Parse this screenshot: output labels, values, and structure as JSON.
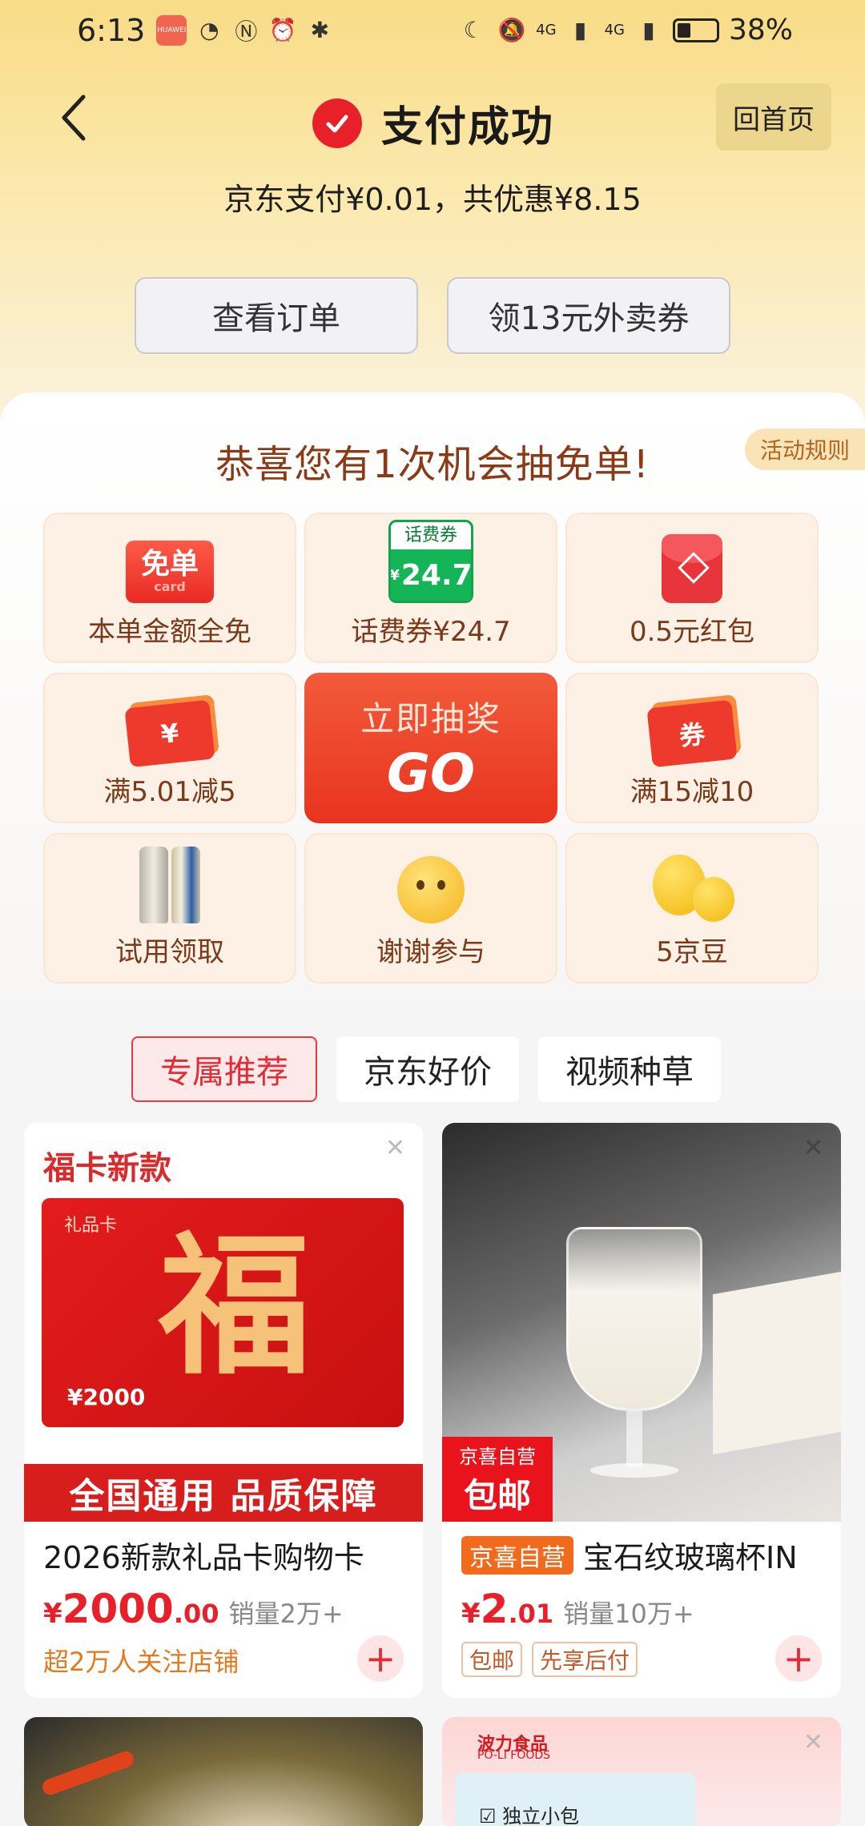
{
  "status_bar": {
    "time": "6:13",
    "app_badge": "HUAWEI",
    "network_1": "4G",
    "network_2": "4G",
    "battery": "38%",
    "battery_level": 0.38
  },
  "header": {
    "title": "支付成功",
    "home_button": "回首页"
  },
  "payment_summary": "京东支付¥0.01，共优惠¥8.15",
  "actions": {
    "view_order": "查看订单",
    "coupon": "领13元外卖券"
  },
  "lottery": {
    "title": "恭喜您有1次机会抽免单!",
    "rules": "活动规则",
    "go_top": "立即抽奖",
    "go_text": "GO",
    "free_icon": "免单",
    "free_icon_sub": "card",
    "phone_icon_top": "话费券",
    "phone_icon_symbol": "¥",
    "phone_icon_value": "24.7",
    "ticket_yen": "¥",
    "ticket_quan": "券",
    "items": [
      {
        "label": "本单金额全免",
        "icon": "free-order-icon"
      },
      {
        "label": "话费券¥24.7",
        "icon": "phone-credit-icon"
      },
      {
        "label": "0.5元红包",
        "icon": "red-packet-icon"
      },
      {
        "label": "满5.01减5",
        "icon": "yen-ticket-icon"
      },
      {
        "label": "满15减10",
        "icon": "coupon-ticket-icon"
      },
      {
        "label": "试用领取",
        "icon": "beer-can-icon"
      },
      {
        "label": "谢谢参与",
        "icon": "sad-face-icon"
      },
      {
        "label": "5京豆",
        "icon": "jd-bean-icon"
      }
    ]
  },
  "tabs": [
    {
      "label": "专属推荐",
      "active": true
    },
    {
      "label": "京东好价",
      "active": false
    },
    {
      "label": "视频种草",
      "active": false
    }
  ],
  "products": [
    {
      "card_title": "福卡新款",
      "image_label": "礼品卡",
      "image_glyph": "福",
      "image_amount": "¥2000",
      "banner": "全国通用 品质保障",
      "name": "2026新款礼品卡购物卡",
      "price_symbol": "¥",
      "price_int": "2000",
      "price_dec": ".00",
      "sales": "销量2万+",
      "extra": "超2万人关注店铺"
    },
    {
      "image_tag_small": "京喜自营",
      "image_tag_big": "包邮",
      "badge": "京喜自营",
      "name": "宝石纹玻璃杯IN",
      "price_symbol": "¥",
      "price_int": "2",
      "price_dec": ".01",
      "sales": "销量10万+",
      "tags": [
        "包邮",
        "先享后付"
      ]
    },
    {
      "brand": "波力食品",
      "brand_en": "PO-LI FOODS",
      "label": "独立小包"
    }
  ],
  "colors": {
    "accent_red": "#e8202a",
    "header_gold": "#f8dc86",
    "lottery_brown": "#8a3a15"
  }
}
